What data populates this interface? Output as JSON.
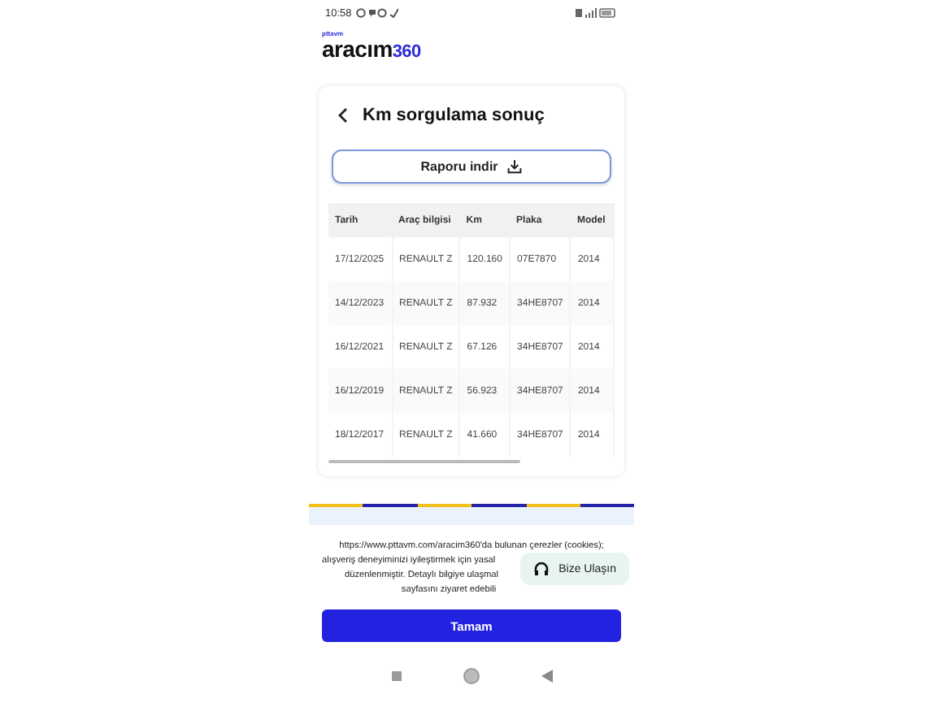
{
  "status_bar": {
    "time": "10:58"
  },
  "logo": {
    "small": "pttavm",
    "main": "aracım",
    "accent": "360"
  },
  "title": "Km sorgulama sonuç",
  "download_button": "Raporu indir",
  "table": {
    "columns": [
      "Tarih",
      "Araç bilgisi",
      "Km",
      "Plaka",
      "Model"
    ],
    "rows": [
      [
        "17/12/2025",
        "RENAULT Z",
        "120.160",
        "07E7870",
        "2014"
      ],
      [
        "14/12/2023",
        "RENAULT Z",
        "87.932",
        "34HE8707",
        "2014"
      ],
      [
        "16/12/2021",
        "RENAULT Z",
        "67.126",
        "34HE8707",
        "2014"
      ],
      [
        "16/12/2019",
        "RENAULT Z",
        "56.923",
        "34HE8707",
        "2014"
      ],
      [
        "18/12/2017",
        "RENAULT Z",
        "41.660",
        "34HE8707",
        "2014"
      ]
    ]
  },
  "cookie_lines": [
    "https://www.pttavm.com/aracim360'da bulunan çerezler (cookies);",
    "alışveriş deneyiminizi iyileştirmek için yasal",
    "düzenlenmiştir. Detaylı bilgiye ulaşmal",
    "sayfasını ziyaret edebili"
  ],
  "contact_chip": "Bize Ulaşın",
  "ok_button": "Tamam"
}
